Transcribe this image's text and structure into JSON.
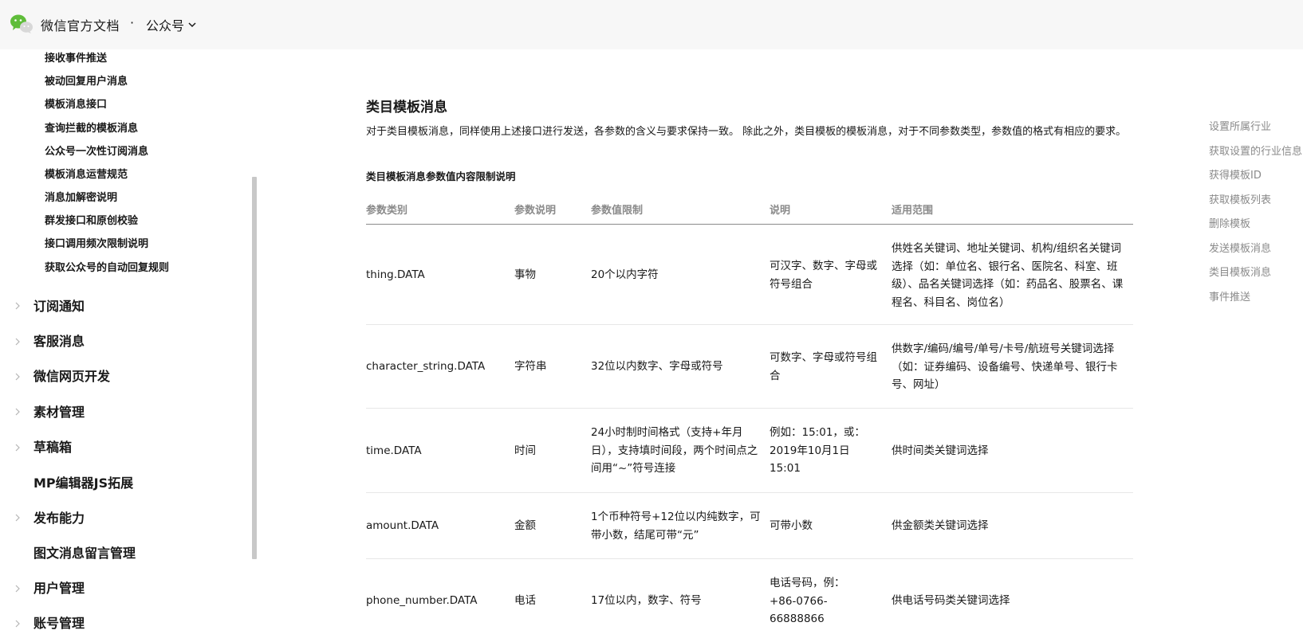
{
  "header": {
    "brand": "微信官方文档",
    "separator": "·",
    "section": "公众号"
  },
  "sidebar": {
    "sub_items": [
      "接收事件推送",
      "被动回复用户消息",
      "模板消息接口",
      "查询拦截的模板消息",
      "公众号一次性订阅消息",
      "模板消息运营规范",
      "消息加解密说明",
      "群发接口和原创校验",
      "接口调用频次限制说明",
      "获取公众号的自动回复规则"
    ],
    "categories": [
      {
        "label": "订阅通知",
        "expandable": true
      },
      {
        "label": "客服消息",
        "expandable": true
      },
      {
        "label": "微信网页开发",
        "expandable": true
      },
      {
        "label": "素材管理",
        "expandable": true
      },
      {
        "label": "草稿箱",
        "expandable": true
      },
      {
        "label": "MP编辑器JS拓展",
        "expandable": false
      },
      {
        "label": "发布能力",
        "expandable": true
      },
      {
        "label": "图文消息留言管理",
        "expandable": false
      },
      {
        "label": "用户管理",
        "expandable": true
      },
      {
        "label": "账号管理",
        "expandable": true
      }
    ]
  },
  "content": {
    "title": "类目模板消息",
    "paragraph": "对于类目模板消息，同样使用上述接口进行发送，各参数的含义与要求保持一致。 除此之外，类目模板的模板消息，对于不同参数类型，参数值的格式有相应的要求。",
    "table_title": "类目模板消息参数值内容限制说明",
    "table": {
      "headers": [
        "参数类别",
        "参数说明",
        "参数值限制",
        "说明",
        "适用范围"
      ],
      "rows": [
        [
          "thing.DATA",
          "事物",
          "20个以内字符",
          "可汉字、数字、字母或符号组合",
          "供姓名关键词、地址关键词、机构/组织名关键词选择（如：单位名、银行名、医院名、科室、班级）、品名关键词选择（如：药品名、股票名、课程名、科目名、岗位名）"
        ],
        [
          "character_string.DATA",
          "字符串",
          "32位以内数字、字母或符号",
          "可数字、字母或符号组合",
          "供数字/编码/编号/单号/卡号/航班号关键词选择（如：证券编码、设备编号、快递单号、银行卡号、网址）"
        ],
        [
          "time.DATA",
          "时间",
          "24小时制时间格式（支持+年月日），支持填时间段，两个时间点之间用“~”符号连接",
          "例如：15:01，或：2019年10月1日 15:01",
          "供时间类关键词选择"
        ],
        [
          "amount.DATA",
          "金额",
          "1个币种符号+12位以内纯数字，可带小数，结尾可带“元”",
          "可带小数",
          "供金额类关键词选择"
        ],
        [
          "phone_number.DATA",
          "电话",
          "17位以内，数字、符号",
          "电话号码，例：+86-0766-66888866",
          "供电话号码类关键词选择"
        ]
      ]
    }
  },
  "toc": {
    "items": [
      "设置所属行业",
      "获取设置的行业信息",
      "获得模板ID",
      "获取模板列表",
      "删除模板",
      "发送模板消息",
      "类目模板消息",
      "事件推送"
    ]
  },
  "colors": {
    "topbar_bg": "#f7f7f7",
    "muted_text": "#8a8a8a",
    "logo_green": "#5fbd3a",
    "scroll_thumb": "#c8c8c8"
  }
}
